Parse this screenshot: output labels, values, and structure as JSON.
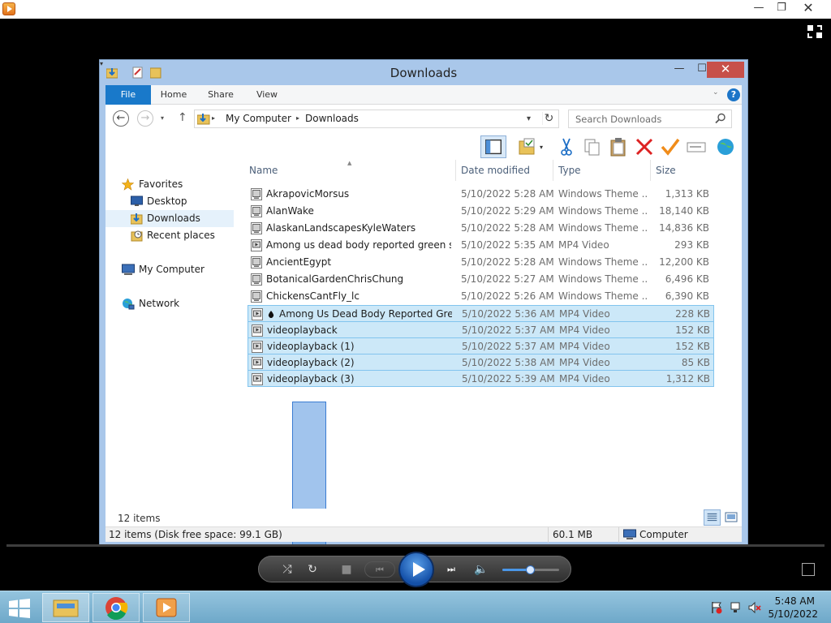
{
  "player": {
    "minimize_glyph": "—",
    "restore_glyph": "❐",
    "close_glyph": "✕",
    "controls": {
      "shuffle_glyph": "⤮",
      "repeat_glyph": "↻",
      "stop_glyph": "■",
      "prev_glyph": "⏮",
      "next_glyph": "⏭",
      "mute_glyph": "🔈",
      "volume": 0.5
    }
  },
  "explorer": {
    "title": "Downloads",
    "minimize_glyph": "—",
    "maximize_glyph": "☐",
    "close_glyph": "✕",
    "ribbon": {
      "tabs": [
        "File",
        "Home",
        "Share",
        "View"
      ],
      "help_glyph": "?",
      "collapse_glyph": "⌄"
    },
    "address": {
      "back_glyph": "←",
      "forward_glyph": "→",
      "up_glyph": "↑",
      "dropdown_glyph": "▾",
      "refresh_glyph": "↻",
      "breadcrumb": [
        "My Computer",
        "Downloads"
      ],
      "separator": "▸",
      "search_placeholder": "Search Downloads"
    },
    "nav_pane": {
      "favorites": "Favorites",
      "desktop": "Desktop",
      "downloads": "Downloads",
      "recent_places": "Recent places",
      "my_computer": "My Computer",
      "network": "Network"
    },
    "columns": {
      "name": "Name",
      "date_modified": "Date modified",
      "type": "Type",
      "size": "Size"
    },
    "files": [
      {
        "name": "AkrapovicMorsus",
        "date": "5/10/2022 5:28 AM",
        "type": "Windows Theme ...",
        "size": "1,313 KB",
        "icon": "theme-file-icon",
        "selected": false
      },
      {
        "name": "AlanWake",
        "date": "5/10/2022 5:29 AM",
        "type": "Windows Theme ...",
        "size": "18,140 KB",
        "icon": "theme-file-icon",
        "selected": false
      },
      {
        "name": "AlaskanLandscapesKyleWaters",
        "date": "5/10/2022 5:28 AM",
        "type": "Windows Theme ...",
        "size": "14,836 KB",
        "icon": "theme-file-icon",
        "selected": false
      },
      {
        "name": "Among us dead body reported green scr...",
        "date": "5/10/2022 5:35 AM",
        "type": "MP4 Video",
        "size": "293 KB",
        "icon": "video-file-icon",
        "selected": false
      },
      {
        "name": "AncientEgypt",
        "date": "5/10/2022 5:28 AM",
        "type": "Windows Theme ...",
        "size": "12,200 KB",
        "icon": "theme-file-icon",
        "selected": false
      },
      {
        "name": "BotanicalGardenChrisChung",
        "date": "5/10/2022 5:27 AM",
        "type": "Windows Theme ...",
        "size": "6,496 KB",
        "icon": "theme-file-icon",
        "selected": false
      },
      {
        "name": "ChickensCantFly_lc",
        "date": "5/10/2022 5:26 AM",
        "type": "Windows Theme ...",
        "size": "6,390 KB",
        "icon": "theme-file-icon",
        "selected": false
      },
      {
        "name": "Among Us Dead Body Reported Green...",
        "date": "5/10/2022 5:36 AM",
        "type": "MP4 Video",
        "size": "228 KB",
        "icon": "video-file-icon",
        "selected": true,
        "has_dot": true
      },
      {
        "name": "videoplayback",
        "date": "5/10/2022 5:37 AM",
        "type": "MP4 Video",
        "size": "152 KB",
        "icon": "video-file-icon",
        "selected": true
      },
      {
        "name": "videoplayback (1)",
        "date": "5/10/2022 5:37 AM",
        "type": "MP4 Video",
        "size": "152 KB",
        "icon": "video-file-icon",
        "selected": true
      },
      {
        "name": "videoplayback (2)",
        "date": "5/10/2022 5:38 AM",
        "type": "MP4 Video",
        "size": "85 KB",
        "icon": "video-file-icon",
        "selected": true
      },
      {
        "name": "videoplayback (3)",
        "date": "5/10/2022 5:39 AM",
        "type": "MP4 Video",
        "size": "1,312 KB",
        "icon": "video-file-icon",
        "selected": true
      }
    ],
    "items_count": "12 items",
    "status": {
      "left": "12 items (Disk free space: 99.1 GB)",
      "size": "60.1 MB",
      "location": "Computer"
    }
  },
  "taskbar": {
    "time": "5:48 AM",
    "date": "5/10/2022"
  },
  "colors": {
    "selection_fill": "#cce8f8",
    "selection_border": "#82c4ee",
    "file_tab": "#1979ca",
    "taskbar": "#7fb3d1"
  }
}
